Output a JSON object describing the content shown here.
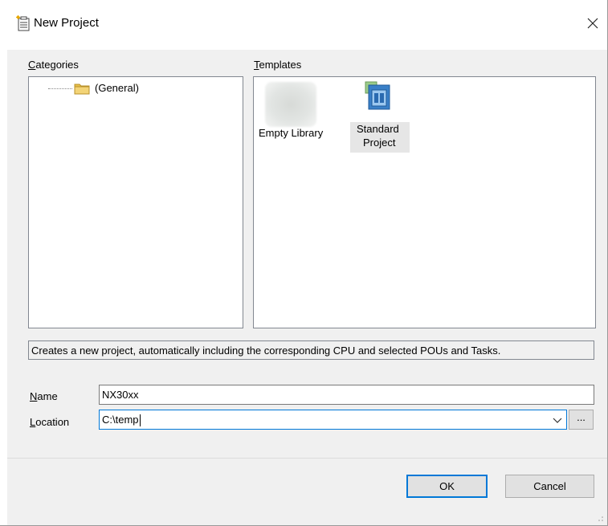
{
  "window": {
    "title": "New Project"
  },
  "icons": {
    "title": "new-project-icon",
    "close": "close-icon",
    "folder": "folder-icon",
    "template_standard": "standard-project-icon",
    "dropdown": "chevron-down-icon"
  },
  "categories": {
    "label_prefix": "",
    "label_mnemonic": "C",
    "label_rest": "ategories",
    "items": [
      {
        "label": "(General)"
      }
    ]
  },
  "templates": {
    "label_mnemonic": "T",
    "label_rest": "emplates",
    "items": [
      {
        "label": "Empty Library",
        "selected": false
      },
      {
        "label_line1": "Standard",
        "label_line2": "Project",
        "selected": true
      }
    ]
  },
  "description": "Creates a new project, automatically including the corresponding CPU and selected POUs and Tasks.",
  "name_field": {
    "label_mnemonic": "N",
    "label_rest": "ame",
    "value": "NX30xx"
  },
  "location_field": {
    "label_mnemonic": "L",
    "label_rest": "ocation",
    "value": "C:\\temp"
  },
  "browse_label": "...",
  "buttons": {
    "ok": "OK",
    "cancel": "Cancel"
  },
  "colors": {
    "accent": "#0078d7",
    "dialog_bg": "#f0f0f0",
    "folder": "#e8c04a"
  }
}
